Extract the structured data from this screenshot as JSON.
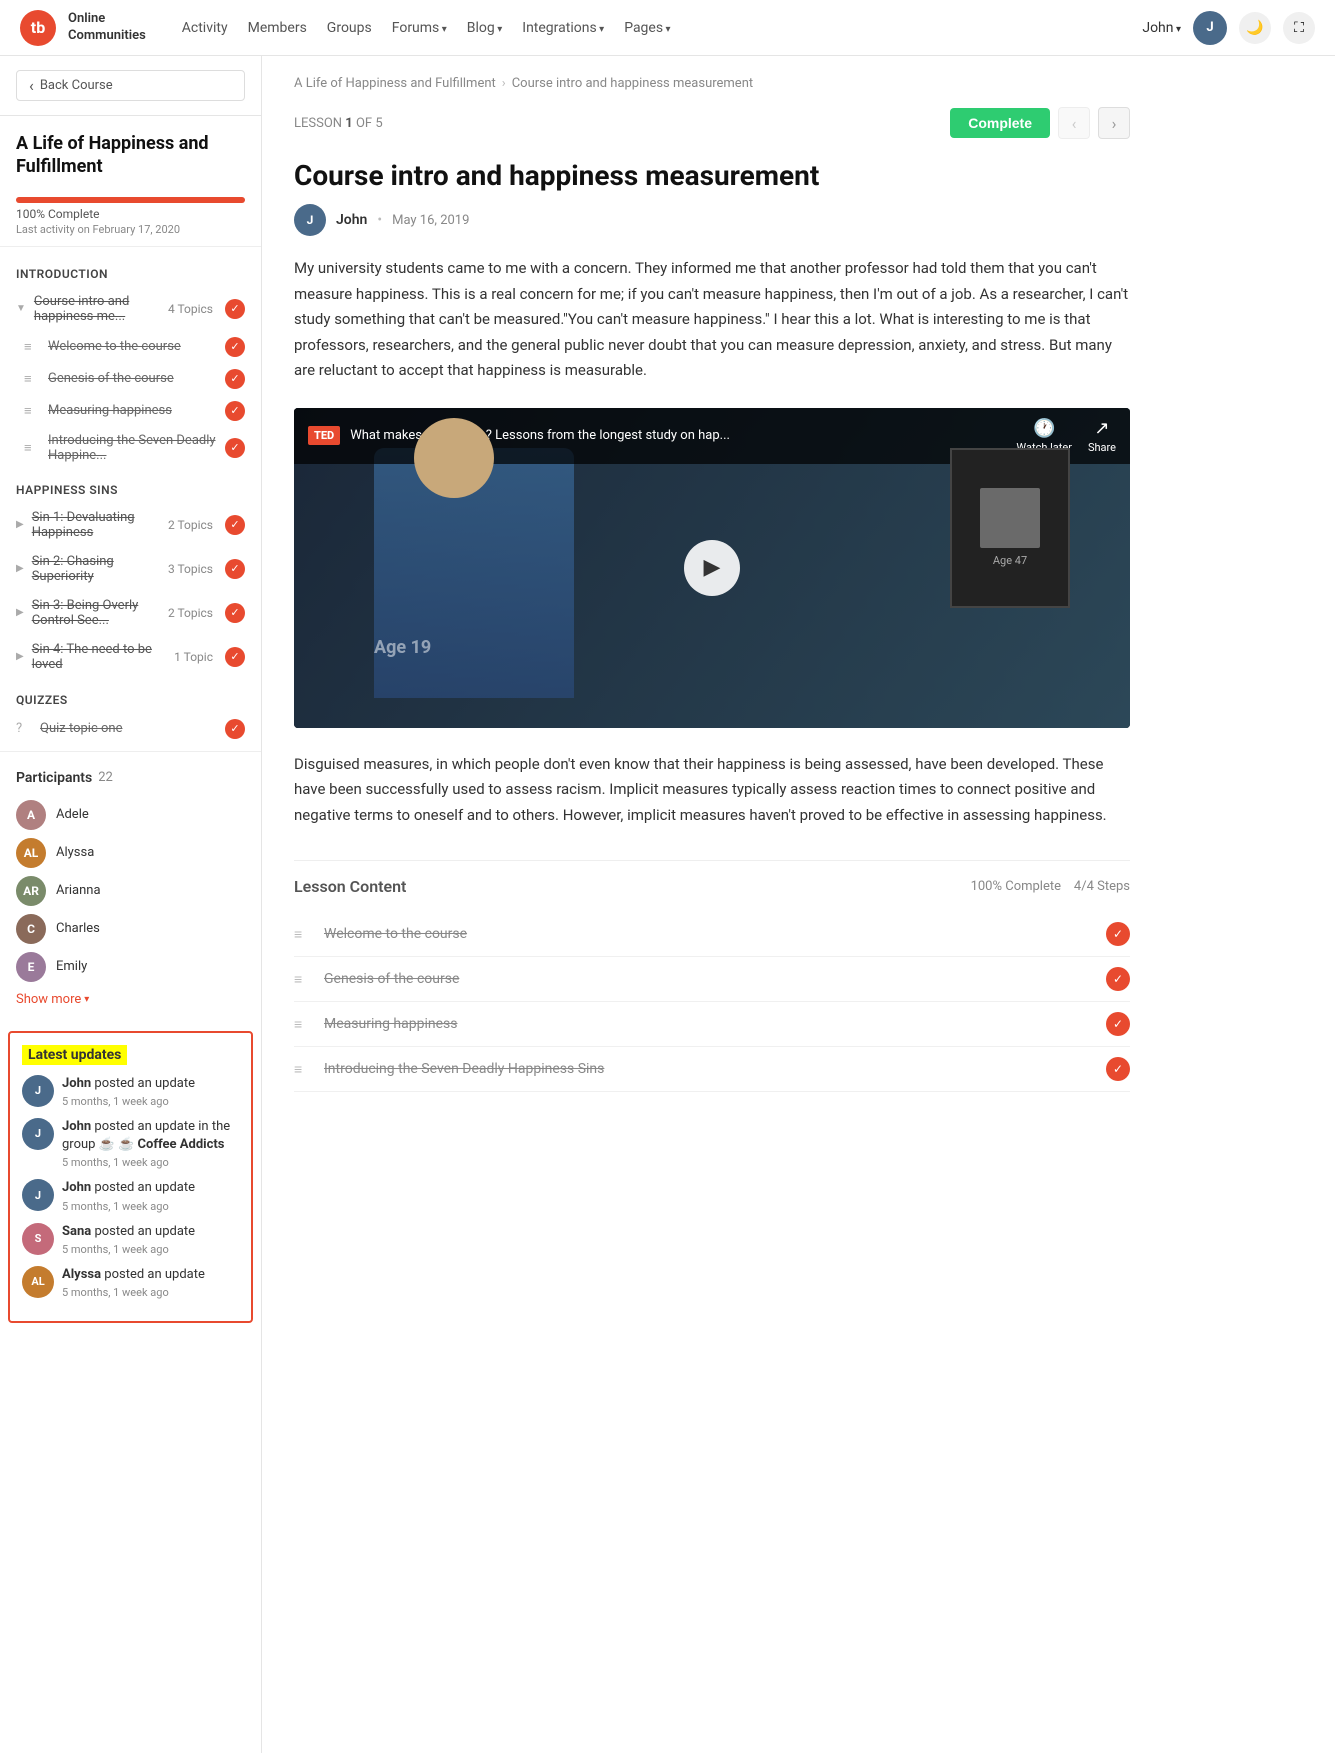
{
  "nav": {
    "logo_text": "tb",
    "site_name": "Online\nCommunities",
    "links": [
      {
        "label": "Activity",
        "has_arrow": false
      },
      {
        "label": "Members",
        "has_arrow": false
      },
      {
        "label": "Groups",
        "has_arrow": false
      },
      {
        "label": "Forums",
        "has_arrow": true
      },
      {
        "label": "Blog",
        "has_arrow": true
      },
      {
        "label": "Integrations",
        "has_arrow": true
      },
      {
        "label": "Pages",
        "has_arrow": true
      }
    ],
    "user_name": "John",
    "moon_icon": "🌙",
    "expand_icon": "⛶"
  },
  "sidebar": {
    "back_label": "Back Course",
    "course_title": "A Life of Happiness and Fulfillment",
    "progress_pct": 100,
    "progress_text": "100% Complete",
    "last_activity": "Last activity on February 17, 2020",
    "sections": [
      {
        "label": "Introduction",
        "items": [
          {
            "type": "parent",
            "text": "Course intro and happiness me...",
            "badge": "4 Topics",
            "completed": true,
            "expanded": true,
            "children": [
              {
                "text": "Welcome to the course",
                "completed": true
              },
              {
                "text": "Genesis of the course",
                "completed": true
              },
              {
                "text": "Measuring happiness",
                "completed": true
              },
              {
                "text": "Introducing the Seven Deadly Happine...",
                "completed": true
              }
            ]
          }
        ]
      },
      {
        "label": "HAPPINESS SINS",
        "items": [
          {
            "type": "parent",
            "text": "Sin 1: Devaluating Happiness",
            "badge": "2 Topics",
            "completed": true
          },
          {
            "type": "parent",
            "text": "Sin 2: Chasing Superiority",
            "badge": "3 Topics",
            "completed": true
          },
          {
            "type": "parent",
            "text": "Sin 3: Being Overly Control See...",
            "badge": "2 Topics",
            "completed": true
          },
          {
            "type": "parent",
            "text": "Sin 4: The need to be loved",
            "badge": "1 Topic",
            "completed": true
          }
        ]
      },
      {
        "label": "Quizzes",
        "items": [
          {
            "type": "quiz",
            "text": "Quiz topic one",
            "completed": true
          }
        ]
      }
    ],
    "participants_label": "Participants",
    "participants_count": "22",
    "participants": [
      {
        "name": "Adele",
        "initials": "A",
        "color": "av-adele"
      },
      {
        "name": "Alyssa",
        "initials": "AL",
        "color": "av-alyssa"
      },
      {
        "name": "Arianna",
        "initials": "AR",
        "color": "av-arianna"
      },
      {
        "name": "Charles",
        "initials": "C",
        "color": "av-charles"
      },
      {
        "name": "Emily",
        "initials": "E",
        "color": "av-emily"
      }
    ],
    "show_more": "Show more",
    "latest_updates_title": "Latest updates",
    "updates": [
      {
        "user": "John",
        "text": "posted an update",
        "time": "5 months, 1 week ago",
        "color": "av-john",
        "initials": "J"
      },
      {
        "user": "John",
        "text": "posted an update in the group",
        "group": "☕ Coffee Addicts",
        "time": "5 months, 1 week ago",
        "color": "av-john",
        "initials": "J"
      },
      {
        "user": "John",
        "text": "posted an update",
        "time": "5 months, 1 week ago",
        "color": "av-john",
        "initials": "J"
      },
      {
        "user": "Sana",
        "text": "posted an update",
        "time": "5 months, 1 week ago",
        "color": "av-sana",
        "initials": "S"
      },
      {
        "user": "Alyssa",
        "text": "posted an update",
        "time": "5 months, 1 week ago",
        "color": "av-alyssa",
        "initials": "AL"
      }
    ]
  },
  "main": {
    "breadcrumb_course": "A Life of Happiness and Fulfillment",
    "breadcrumb_lesson": "Course intro and happiness measurement",
    "lesson_label": "LESSON",
    "lesson_num": "1",
    "lesson_of": "OF 5",
    "complete_btn": "Complete",
    "course_title": "Course intro and happiness measurement",
    "author_name": "John",
    "author_date": "May 16, 2019",
    "article_p1": "My university students came to me with a concern. They informed me that another professor had told them that you can't measure happiness. This is a real concern for me; if you can't measure happiness, then I'm out of a job. As a researcher, I can't study something that can't be measured.\"You can't measure happiness.\" I hear this a lot. What is interesting to me is that professors, researchers, and the general public never doubt that you can measure depression, anxiety, and stress. But many are reluctant to accept that happiness is measurable.",
    "video_ted": "TED",
    "video_title": "What makes a good life? Lessons from the longest study on hap...",
    "video_watch_later": "Watch later",
    "video_share": "Share",
    "video_age1": "Age 19",
    "video_age2": "Age 47",
    "article_p2": "Disguised measures, in which people don't even know that their happiness is being assessed, have been developed. These have been successfully used to assess racism. Implicit measures typically assess reaction times to connect positive and negative terms to oneself and to others. However, implicit measures haven't proved to be effective in assessing happiness.",
    "lesson_content_title": "Lesson Content",
    "lesson_content_meta": "100% Complete",
    "lesson_content_steps_meta": "4/4 Steps",
    "steps": [
      {
        "text": "Welcome to the course",
        "completed": true
      },
      {
        "text": "Genesis of the course",
        "completed": true
      },
      {
        "text": "Measuring happiness",
        "completed": true
      },
      {
        "text": "Introducing the Seven Deadly Happiness Sins",
        "completed": true
      }
    ]
  }
}
